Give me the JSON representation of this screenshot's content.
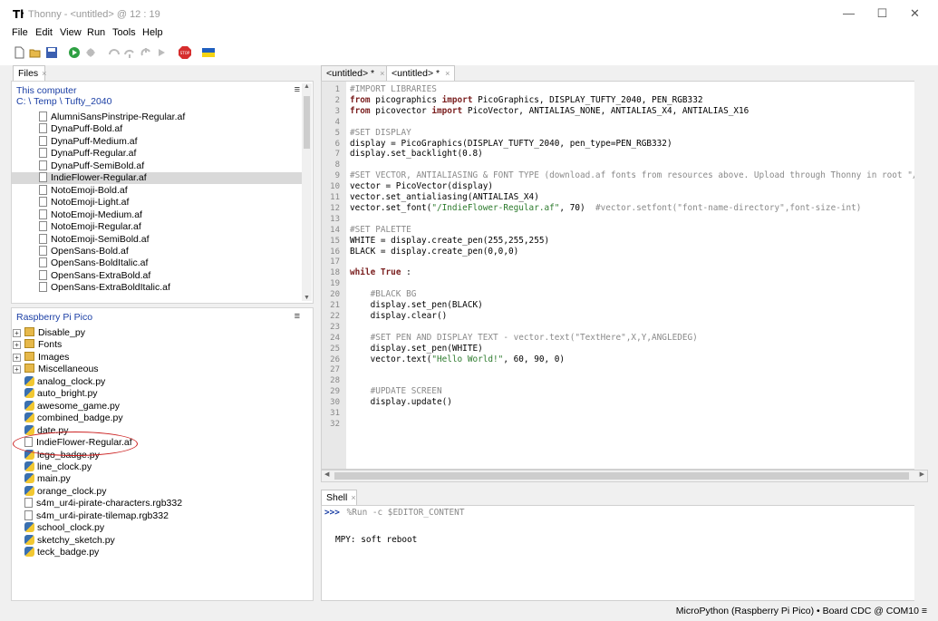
{
  "window": {
    "title": "Thonny  -  <untitled>  @  12 : 19",
    "minimize": "—",
    "maximize": "☐",
    "close": "✕"
  },
  "menu": [
    "File",
    "Edit",
    "View",
    "Run",
    "Tools",
    "Help"
  ],
  "toolbar": {
    "icons": [
      "new-file-icon",
      "open-folder-icon",
      "save-icon",
      "run-icon",
      "debug-icon",
      "step-over-icon",
      "step-into-icon",
      "step-out-icon",
      "resume-icon",
      "stop-icon",
      "ukraine-flag-icon"
    ],
    "stop_label": "STOP"
  },
  "files_panel": {
    "tab_label": "Files",
    "tab_close": "×",
    "location_title": "This computer",
    "breadcrumb": [
      "C:",
      "\\",
      "Temp",
      "\\",
      "Tufty_2040"
    ],
    "menu_glyph": "≡",
    "items": [
      "AlumniSansPinstripe-Regular.af",
      "DynaPuff-Bold.af",
      "DynaPuff-Medium.af",
      "DynaPuff-Regular.af",
      "DynaPuff-SemiBold.af",
      "IndieFlower-Regular.af",
      "NotoEmoji-Bold.af",
      "NotoEmoji-Light.af",
      "NotoEmoji-Medium.af",
      "NotoEmoji-Regular.af",
      "NotoEmoji-SemiBold.af",
      "OpenSans-Bold.af",
      "OpenSans-BoldItalic.af",
      "OpenSans-ExtraBold.af",
      "OpenSans-ExtraBoldItalic.af"
    ],
    "selected_item": "IndieFlower-Regular.af"
  },
  "pico_panel": {
    "title": "Raspberry Pi Pico",
    "menu_glyph": "≡",
    "folders": [
      "Disable_py",
      "Fonts",
      "Images",
      "Miscellaneous"
    ],
    "files": [
      {
        "name": "analog_clock.py",
        "type": "py"
      },
      {
        "name": "auto_bright.py",
        "type": "py"
      },
      {
        "name": "awesome_game.py",
        "type": "py"
      },
      {
        "name": "combined_badge.py",
        "type": "py"
      },
      {
        "name": "date.py",
        "type": "py"
      },
      {
        "name": "IndieFlower-Regular.af",
        "type": "file"
      },
      {
        "name": "lego_badge.py",
        "type": "py"
      },
      {
        "name": "line_clock.py",
        "type": "py"
      },
      {
        "name": "main.py",
        "type": "py"
      },
      {
        "name": "orange_clock.py",
        "type": "py"
      },
      {
        "name": "s4m_ur4i-pirate-characters.rgb332",
        "type": "file"
      },
      {
        "name": "s4m_ur4i-pirate-tilemap.rgb332",
        "type": "file"
      },
      {
        "name": "school_clock.py",
        "type": "py"
      },
      {
        "name": "sketchy_sketch.py",
        "type": "py"
      },
      {
        "name": "teck_badge.py",
        "type": "py"
      }
    ],
    "highlighted_item": "IndieFlower-Regular.af"
  },
  "editor": {
    "tabs": [
      "<untitled> *",
      "<untitled> *"
    ],
    "tab_close": "×",
    "line_count": 32,
    "lines": [
      [
        [
          "cm",
          "#IMPORT LIBRARIES"
        ]
      ],
      [
        [
          "kw",
          "from"
        ],
        [
          "",
          "picographics "
        ],
        [
          "kw",
          "import"
        ],
        [
          "",
          "PicoGraphics, DISPLAY_TUFTY_2040, PEN_RGB332"
        ]
      ],
      [
        [
          "kw",
          "from"
        ],
        [
          "",
          "picovector "
        ],
        [
          "kw",
          "import"
        ],
        [
          "",
          "PicoVector, ANTIALIAS_NONE, ANTIALIAS_X4, ANTIALIAS_X16"
        ]
      ],
      [],
      [
        [
          "cm",
          "#SET DISPLAY"
        ]
      ],
      [
        [
          "",
          "display = PicoGraphics(DISPLAY_TUFTY_2040, pen_type=PEN_RGB332)"
        ]
      ],
      [
        [
          "",
          "display.set_backlight(0.8)"
        ]
      ],
      [],
      [
        [
          "cm",
          "#SET VECTOR, ANTIALIASING & FONT TYPE (download.af fonts from resources above. Upload through Thonny in root \"/\""
        ]
      ],
      [
        [
          "",
          "vector = PicoVector(display)"
        ]
      ],
      [
        [
          "",
          "vector.set_antialiasing(ANTIALIAS_X4)"
        ]
      ],
      [
        [
          "",
          "vector.set_font("
        ],
        [
          "str",
          "\"/IndieFlower-Regular.af\""
        ],
        [
          "",
          ", 70)  "
        ],
        [
          "cm",
          "#vector.setfont(\"font-name-directory\",font-size-int)"
        ]
      ],
      [],
      [
        [
          "cm",
          "#SET PALETTE"
        ]
      ],
      [
        [
          "",
          "WHITE = display.create_pen(255,255,255)"
        ]
      ],
      [
        [
          "",
          "BLACK = display.create_pen(0,0,0)"
        ]
      ],
      [],
      [
        [
          "kw",
          "while"
        ],
        [
          "",
          ""
        ],
        [
          "kw",
          "True"
        ],
        [
          "",
          ":"
        ]
      ],
      [],
      [
        [
          "",
          "    "
        ],
        [
          "cm",
          "#BLACK BG"
        ]
      ],
      [
        [
          "",
          "    display.set_pen(BLACK)"
        ]
      ],
      [
        [
          "",
          "    display.clear()"
        ]
      ],
      [],
      [
        [
          "",
          "    "
        ],
        [
          "cm",
          "#SET PEN AND DISPLAY TEXT - vector.text(\"TextHere\",X,Y,ANGLEDEG)"
        ]
      ],
      [
        [
          "",
          "    display.set_pen(WHITE)"
        ]
      ],
      [
        [
          "",
          "    vector.text("
        ],
        [
          "str",
          "\"Hello World!\""
        ],
        [
          "",
          ", 60, 90, 0)"
        ]
      ],
      [],
      [],
      [
        [
          "",
          "    "
        ],
        [
          "cm",
          "#UPDATE SCREEN"
        ]
      ],
      [
        [
          "",
          "    display.update()"
        ]
      ],
      [],
      []
    ]
  },
  "shell": {
    "tab_label": "Shell",
    "tab_close": "×",
    "prompt": ">>>",
    "command": " %Run -c $EDITOR_CONTENT",
    "output": "MPY: soft reboot"
  },
  "statusbar": {
    "text": "MicroPython (Raspberry Pi Pico)  •  Board CDC @ COM10  ≡"
  },
  "colors": {
    "keyword": "#7a1f1f",
    "comment": "#8a8a8a",
    "string": "#2c7a2c",
    "link": "#1b3fa5",
    "annotation": "#cc2222"
  }
}
